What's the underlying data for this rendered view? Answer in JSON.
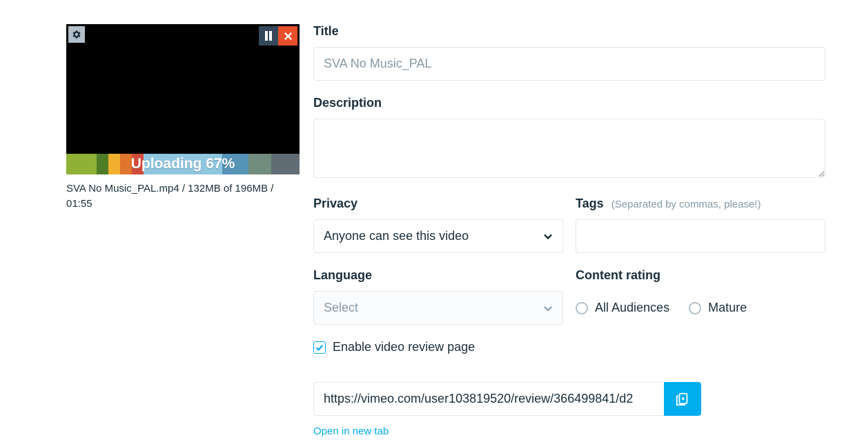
{
  "preview": {
    "upload_status": "Uploading 67%",
    "file_meta": "SVA No Music_PAL.mp4 / 132MB of 196MB / 01:55"
  },
  "form": {
    "title_label": "Title",
    "title_placeholder": "SVA No Music_PAL",
    "description_label": "Description",
    "privacy": {
      "label": "Privacy",
      "selected": "Anyone can see this video"
    },
    "tags": {
      "label": "Tags",
      "hint": "(Separated by commas, please!)"
    },
    "language": {
      "label": "Language",
      "placeholder": "Select"
    },
    "content_rating": {
      "label": "Content rating",
      "option_all": "All Audiences",
      "option_mature": "Mature"
    },
    "review_checkbox_label": "Enable video review page",
    "review_url": "https://vimeo.com/user103819520/review/366499841/d2",
    "open_link_label": "Open in new tab"
  }
}
